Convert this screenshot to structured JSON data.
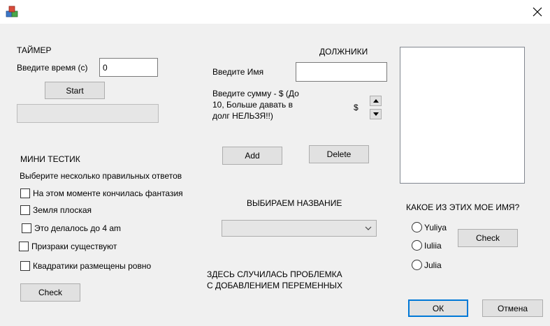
{
  "window": {
    "icon": "app-cubes-icon",
    "close_icon": "close-icon"
  },
  "timer": {
    "heading": "ТАЙМЕР",
    "time_label": "Введите время (с)",
    "time_value": "0",
    "start_label": "Start",
    "progress": 0
  },
  "debtors": {
    "heading": "ДОЛЖНИКИ",
    "name_label": "Введите Имя",
    "name_value": "",
    "sum_label_line1": "Введите сумму - $ (До",
    "sum_label_line2": "10, Больше давать в",
    "sum_label_line3": "долг НЕЛЬЗЯ!!)",
    "currency": "$",
    "add_label": "Add",
    "delete_label": "Delete"
  },
  "quiz": {
    "heading": "МИНИ ТЕСТИК",
    "instruction": "Выберите несколько правильных ответов",
    "options": [
      {
        "label": "На этом моменте кончилась фантазия",
        "checked": false
      },
      {
        "label": "Земля плоская",
        "checked": false
      },
      {
        "label": "Это делалось до 4 am",
        "checked": false
      },
      {
        "label": "Призраки существуют",
        "checked": false
      },
      {
        "label": "Квадратики размещены ровно",
        "checked": false
      }
    ],
    "check_label": "Check"
  },
  "naming": {
    "heading": "ВЫБИРАЕМ НАЗВАНИЕ",
    "combo_value": "",
    "problem_line1": "ЗДЕСЬ СЛУЧИЛАСЬ ПРОБЛЕМКА",
    "problem_line2": "С ДОБАВЛЕНИЕМ ПЕРЕМЕННЫХ"
  },
  "name_question": {
    "heading": "КАКОЕ ИЗ ЭТИХ МОЕ ИМЯ?",
    "options": [
      "Yuliya",
      "Iuliia",
      "Julia"
    ],
    "check_label": "Check"
  },
  "dialog": {
    "ok_label": "ОК",
    "cancel_label": "Отмена"
  }
}
